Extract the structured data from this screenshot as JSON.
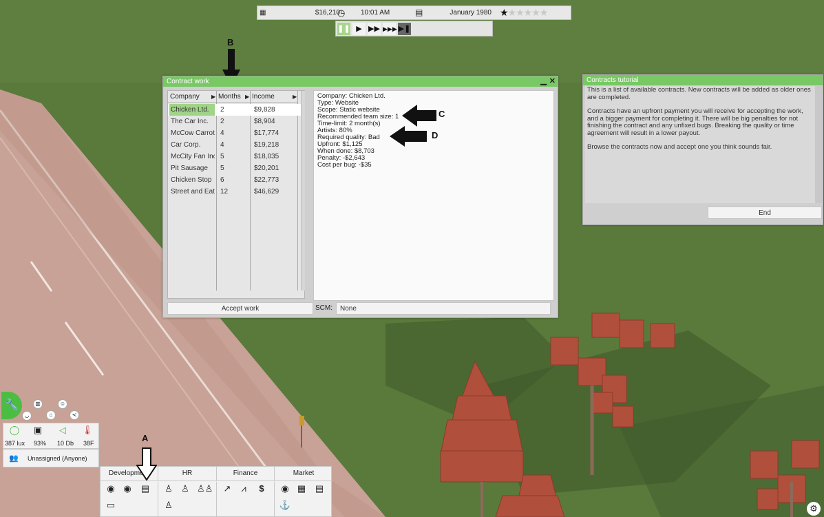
{
  "topbar": {
    "money": "$16,210",
    "time": "10:01 AM",
    "date": "January 1980",
    "stars_filled": 1,
    "stars_total": 6
  },
  "speed_controls": {
    "pause_icon": "pause-icon",
    "play_icon": "play-icon",
    "fast_icon": "fast-forward-icon",
    "faster_icon": "fastest-forward-icon",
    "skip_icon": "skip-icon"
  },
  "contract_window": {
    "title": "Contract work",
    "columns": [
      "Company",
      "Months",
      "Income"
    ],
    "rows": [
      {
        "company": "Chicken Ltd.",
        "months": "2",
        "income": "$9,828",
        "selected": true
      },
      {
        "company": "The Car Inc.",
        "months": "2",
        "income": "$8,904"
      },
      {
        "company": "McCow Carrot Corp.",
        "months": "4",
        "income": "$17,774"
      },
      {
        "company": "Car Corp.",
        "months": "4",
        "income": "$19,218"
      },
      {
        "company": "McCity Fan Inc.",
        "months": "5",
        "income": "$18,035"
      },
      {
        "company": "Pit Sausage",
        "months": "5",
        "income": "$20,201"
      },
      {
        "company": "Chicken Stop",
        "months": "6",
        "income": "$22,773"
      },
      {
        "company": "Street and Eat",
        "months": "12",
        "income": "$46,629"
      }
    ],
    "details": [
      "Company: Chicken Ltd.",
      "Type: Website",
      "Scope: Static website",
      "Recommended team size: 1",
      "Time-limit: 2 month(s)",
      "Artists: 80%",
      "Required quality: Bad",
      "Upfront: $1,125",
      "When done: $8,703",
      "Penalty: -$2,643",
      "Cost per bug: -$35"
    ],
    "accept_label": "Accept work",
    "scm_label": "SCM:",
    "scm_value": "None"
  },
  "tutorial_window": {
    "title": "Contracts tutorial",
    "paragraphs": [
      "This is a list of available contracts. New contracts will be added as older ones are completed.",
      "Contracts have an upfront payment you will receive for accepting the work, and a bigger payment for completing it. There will be big penalties for not finishing the contract and any unfixed bugs. Breaking the quality or time agreement will result in a lower payout.",
      "Browse the contracts now and accept one you think sounds fair."
    ],
    "end_label": "End"
  },
  "markers": {
    "a": "A",
    "b": "B",
    "c": "C",
    "d": "D"
  },
  "hud": {
    "light": "387 lux",
    "quality": "93%",
    "noise": "10 Db",
    "temp": "38F",
    "team": "Unassigned (Anyone)"
  },
  "bottom_tabs": [
    "Development",
    "HR",
    "Finance",
    "Market"
  ],
  "colors": {
    "grass": "#5a7a3c",
    "road": "#c8a296",
    "title_green": "#78c864",
    "select_green": "#a0d488",
    "tree_red": "#b0503c"
  }
}
